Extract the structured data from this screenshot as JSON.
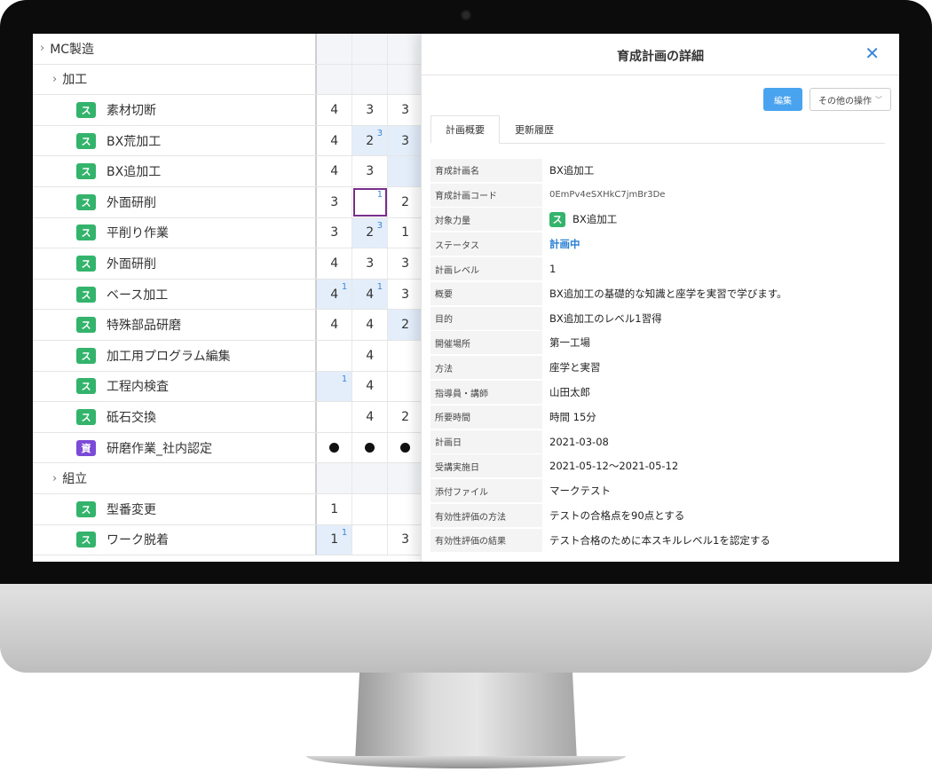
{
  "grid": {
    "rows": [
      {
        "type": "group",
        "level": 0,
        "label": "MC製造",
        "cells": [
          {
            "v": ""
          },
          {
            "v": ""
          },
          {
            "v": ""
          }
        ]
      },
      {
        "type": "group",
        "level": 1,
        "label": "加工",
        "cells": [
          {
            "v": ""
          },
          {
            "v": ""
          },
          {
            "v": ""
          }
        ]
      },
      {
        "type": "item",
        "tag": "ス",
        "tagType": "s",
        "label": "素材切断",
        "cells": [
          {
            "v": "4"
          },
          {
            "v": "3"
          },
          {
            "v": "3"
          }
        ]
      },
      {
        "type": "item",
        "tag": "ス",
        "tagType": "s",
        "label": "BX荒加工",
        "cells": [
          {
            "v": "4"
          },
          {
            "v": "2",
            "sup": "3",
            "hl": true
          },
          {
            "v": "3",
            "hl": true
          }
        ]
      },
      {
        "type": "item",
        "tag": "ス",
        "tagType": "s",
        "label": "BX追加工",
        "cells": [
          {
            "v": "4"
          },
          {
            "v": "3"
          },
          {
            "v": "",
            "hl": true
          }
        ]
      },
      {
        "type": "item",
        "tag": "ス",
        "tagType": "s",
        "label": "外面研削",
        "cells": [
          {
            "v": "3"
          },
          {
            "v": "",
            "sup": "1",
            "sel": true
          },
          {
            "v": "2"
          }
        ]
      },
      {
        "type": "item",
        "tag": "ス",
        "tagType": "s",
        "label": "平削り作業",
        "cells": [
          {
            "v": "3"
          },
          {
            "v": "2",
            "sup": "3",
            "hl": true
          },
          {
            "v": "1"
          }
        ]
      },
      {
        "type": "item",
        "tag": "ス",
        "tagType": "s",
        "label": "外面研削",
        "cells": [
          {
            "v": "4"
          },
          {
            "v": "3"
          },
          {
            "v": "3"
          }
        ]
      },
      {
        "type": "item",
        "tag": "ス",
        "tagType": "s",
        "label": "ベース加工",
        "cells": [
          {
            "v": "4",
            "sup": "1",
            "hl": true
          },
          {
            "v": "4",
            "sup": "1",
            "hl": true
          },
          {
            "v": "3"
          }
        ]
      },
      {
        "type": "item",
        "tag": "ス",
        "tagType": "s",
        "label": "特殊部品研磨",
        "cells": [
          {
            "v": "4"
          },
          {
            "v": "4"
          },
          {
            "v": "2",
            "hl": true
          }
        ]
      },
      {
        "type": "item",
        "tag": "ス",
        "tagType": "s",
        "label": "加工用プログラム編集",
        "cells": [
          {
            "v": ""
          },
          {
            "v": "4"
          },
          {
            "v": ""
          }
        ]
      },
      {
        "type": "item",
        "tag": "ス",
        "tagType": "s",
        "label": "工程内検査",
        "cells": [
          {
            "v": "",
            "sup": "1",
            "hl": true
          },
          {
            "v": "4"
          },
          {
            "v": ""
          }
        ]
      },
      {
        "type": "item",
        "tag": "ス",
        "tagType": "s",
        "label": "砥石交換",
        "cells": [
          {
            "v": ""
          },
          {
            "v": "4"
          },
          {
            "v": "2"
          }
        ]
      },
      {
        "type": "item",
        "tag": "資",
        "tagType": "k",
        "label": "研磨作業_社内認定",
        "cells": [
          {
            "dot": true
          },
          {
            "dot": true
          },
          {
            "dot": true
          }
        ]
      },
      {
        "type": "group",
        "level": 1,
        "label": "組立",
        "cells": [
          {
            "v": ""
          },
          {
            "v": ""
          },
          {
            "v": ""
          }
        ]
      },
      {
        "type": "item",
        "tag": "ス",
        "tagType": "s",
        "label": "型番変更",
        "cells": [
          {
            "v": "1"
          },
          {
            "v": ""
          },
          {
            "v": ""
          }
        ]
      },
      {
        "type": "item",
        "tag": "ス",
        "tagType": "s",
        "label": "ワーク脱着",
        "cells": [
          {
            "v": "1",
            "sup": "1",
            "hl": true
          },
          {
            "v": ""
          },
          {
            "v": "3"
          }
        ]
      }
    ]
  },
  "panel": {
    "title": "育成計画の詳細",
    "edit_label": "編集",
    "more_label": "その他の操作",
    "tabs": [
      "計画概要",
      "更新履歴"
    ],
    "skill_tag": "ス",
    "fields": [
      {
        "label": "育成計画名",
        "value": "BX追加工"
      },
      {
        "label": "育成計画コード",
        "value": "0EmPv4eSXHkC7jmBr3De",
        "kind": "code"
      },
      {
        "label": "対象力量",
        "value": "BX追加工",
        "kind": "skill"
      },
      {
        "label": "ステータス",
        "value": "計画中",
        "kind": "status"
      },
      {
        "label": "計画レベル",
        "value": "1"
      },
      {
        "label": "概要",
        "value": "BX追加工の基礎的な知識と座学を実習で学びます。"
      },
      {
        "label": "目的",
        "value": "BX追加工のレベル1習得"
      },
      {
        "label": "開催場所",
        "value": "第一工場"
      },
      {
        "label": "方法",
        "value": "座学と実習"
      },
      {
        "label": "指導員・講師",
        "value": "山田太郎"
      },
      {
        "label": "所要時間",
        "value": "時間 15分"
      },
      {
        "label": "計画日",
        "value": "2021-03-08"
      },
      {
        "label": "受講実施日",
        "value": "2021-05-12〜2021-05-12"
      },
      {
        "label": "添付ファイル",
        "value": "マークテスト"
      },
      {
        "label": "有効性評価の方法",
        "value": "テストの合格点を90点とする"
      },
      {
        "label": "有効性評価の結果",
        "value": "テスト合格のために本スキルレベル1を認定する"
      }
    ]
  },
  "colors": {
    "skill_tag": "#33b36b",
    "cert_tag": "#7b4bd8",
    "accent": "#3a86d9",
    "selected_cell": "#7a2e8c",
    "highlight_cell": "#e4eefb"
  }
}
